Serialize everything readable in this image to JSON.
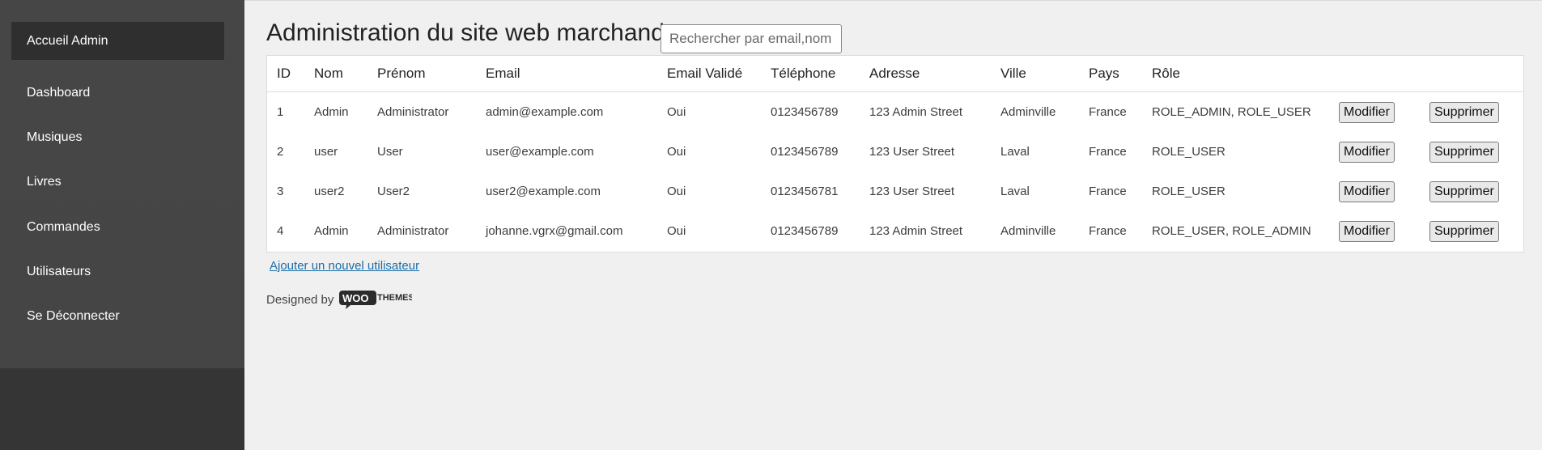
{
  "sidebar": {
    "home": "Accueil Admin",
    "items": [
      {
        "label": "Dashboard"
      },
      {
        "label": "Musiques"
      },
      {
        "label": "Livres"
      },
      {
        "label": "Commandes"
      },
      {
        "label": "Utilisateurs"
      },
      {
        "label": "Se Déconnecter"
      }
    ]
  },
  "header": {
    "title": "Administration du site web marchand",
    "search_placeholder": "Rechercher par email,nom"
  },
  "table": {
    "columns": [
      "ID",
      "Nom",
      "Prénom",
      "Email",
      "Email Validé",
      "Téléphone",
      "Adresse",
      "Ville",
      "Pays",
      "Rôle"
    ],
    "rows": [
      {
        "id": "1",
        "nom": "Admin",
        "prenom": "Administrator",
        "email": "admin@example.com",
        "valide": "Oui",
        "tel": "0123456789",
        "adresse": "123 Admin Street",
        "ville": "Adminville",
        "pays": "France",
        "role": "ROLE_ADMIN, ROLE_USER"
      },
      {
        "id": "2",
        "nom": "user",
        "prenom": "User",
        "email": "user@example.com",
        "valide": "Oui",
        "tel": "0123456789",
        "adresse": "123 User Street",
        "ville": "Laval",
        "pays": "France",
        "role": "ROLE_USER"
      },
      {
        "id": "3",
        "nom": "user2",
        "prenom": "User2",
        "email": "user2@example.com",
        "valide": "Oui",
        "tel": "0123456781",
        "adresse": "123 User Street",
        "ville": "Laval",
        "pays": "France",
        "role": "ROLE_USER"
      },
      {
        "id": "4",
        "nom": "Admin",
        "prenom": "Administrator",
        "email": "johanne.vgrx@gmail.com",
        "valide": "Oui",
        "tel": "0123456789",
        "adresse": "123 Admin Street",
        "ville": "Adminville",
        "pays": "France",
        "role": "ROLE_USER, ROLE_ADMIN"
      }
    ],
    "edit_label": "Modifier",
    "delete_label": "Supprimer"
  },
  "add_user_link": "Ajouter un nouvel utilisateur",
  "footer": {
    "designed_by": "Designed by",
    "logo_text_woo": "WOO",
    "logo_text_themes": "THEMES"
  }
}
